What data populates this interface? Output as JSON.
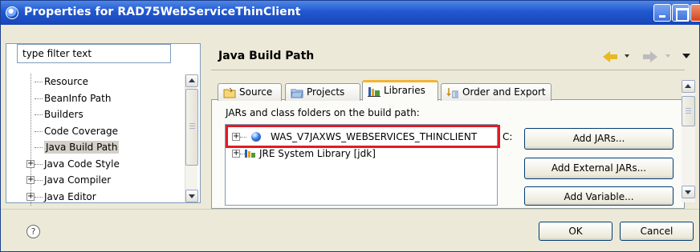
{
  "window": {
    "title": "Properties for RAD75WebServiceThinClient"
  },
  "filter": {
    "value": "type filter text"
  },
  "sidebar": {
    "items": [
      {
        "label": "Resource",
        "expandable": false,
        "selected": false
      },
      {
        "label": "BeanInfo Path",
        "expandable": false,
        "selected": false
      },
      {
        "label": "Builders",
        "expandable": false,
        "selected": false
      },
      {
        "label": "Code Coverage",
        "expandable": false,
        "selected": false
      },
      {
        "label": "Java Build Path",
        "expandable": false,
        "selected": true
      },
      {
        "label": "Java Code Style",
        "expandable": true,
        "expander": "+",
        "selected": false
      },
      {
        "label": "Java Compiler",
        "expandable": true,
        "expander": "+",
        "selected": false
      },
      {
        "label": "Java Editor",
        "expandable": true,
        "expander": "+",
        "selected": false
      }
    ]
  },
  "page": {
    "title": "Java Build Path"
  },
  "tabs": [
    {
      "label": "Source",
      "icon": "source-folder-icon",
      "active": false
    },
    {
      "label": "Projects",
      "icon": "projects-folder-icon",
      "active": false
    },
    {
      "label": "Libraries",
      "icon": "libraries-icon",
      "active": true
    },
    {
      "label": "Order and Export",
      "icon": "order-export-icon",
      "active": false
    }
  ],
  "libraries": {
    "description": "JARs and class folders on the build path:",
    "entries": [
      {
        "label": "WAS_V7JAXWS_WEBSERVICES_THINCLIENT",
        "icon": "classpath-variable-icon",
        "expander": "+",
        "highlighted": true
      },
      {
        "label": "JRE System Library [jdk]",
        "icon": "jre-library-icon",
        "expander": "+",
        "highlighted": false
      }
    ],
    "truncated_suffix": "C:",
    "buttons": {
      "add_jars": "Add JARs...",
      "add_external_jars": "Add External JARs...",
      "add_variable": "Add Variable..."
    }
  },
  "footer": {
    "help_glyph": "?",
    "ok_label": "OK",
    "cancel_label": "Cancel"
  },
  "colors": {
    "title_bar": "#2157cf",
    "highlight_border": "#e11b22",
    "active_tab_accent": "#f3b333",
    "selection_bg": "#d4d0c8"
  }
}
